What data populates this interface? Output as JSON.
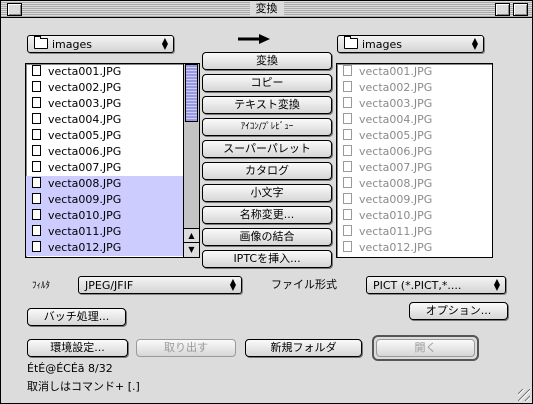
{
  "window": {
    "title": "変換"
  },
  "source": {
    "folder": "images",
    "files": [
      {
        "name": "vecta001.JPG",
        "selected": false
      },
      {
        "name": "vecta002.JPG",
        "selected": false
      },
      {
        "name": "vecta003.JPG",
        "selected": false
      },
      {
        "name": "vecta004.JPG",
        "selected": false
      },
      {
        "name": "vecta005.JPG",
        "selected": false
      },
      {
        "name": "vecta006.JPG",
        "selected": false
      },
      {
        "name": "vecta007.JPG",
        "selected": false
      },
      {
        "name": "vecta008.JPG",
        "selected": true
      },
      {
        "name": "vecta009.JPG",
        "selected": true
      },
      {
        "name": "vecta010.JPG",
        "selected": true
      },
      {
        "name": "vecta011.JPG",
        "selected": true
      },
      {
        "name": "vecta012.JPG",
        "selected": true
      }
    ]
  },
  "destination": {
    "folder": "images",
    "files": [
      "vecta001.JPG",
      "vecta002.JPG",
      "vecta003.JPG",
      "vecta004.JPG",
      "vecta005.JPG",
      "vecta006.JPG",
      "vecta007.JPG",
      "vecta008.JPG",
      "vecta009.JPG",
      "vecta010.JPG",
      "vecta011.JPG",
      "vecta012.JPG"
    ]
  },
  "actions": [
    {
      "id": "convert",
      "label": "変換"
    },
    {
      "id": "copy",
      "label": "コピー"
    },
    {
      "id": "text-convert",
      "label": "テキスト変換"
    },
    {
      "id": "icon-preview",
      "label": "ｱｲｺﾝ/ﾌﾟﾚﾋﾞｭｰ"
    },
    {
      "id": "super-palette",
      "label": "スーパーパレット"
    },
    {
      "id": "catalog",
      "label": "カタログ"
    },
    {
      "id": "lowercase",
      "label": "小文字"
    },
    {
      "id": "rename",
      "label": "名称変更..."
    },
    {
      "id": "combine-images",
      "label": "画像の結合"
    },
    {
      "id": "iptc-insert",
      "label": "IPTCを挿入..."
    }
  ],
  "filter": {
    "label": "ﾌｨﾙﾀ",
    "value": "JPEG/JFIF"
  },
  "file_format": {
    "label": "ファイル形式",
    "value": "PICT (*.PICT,*...."
  },
  "buttons": {
    "batch": "バッチ処理...",
    "options": "オプション...",
    "env_settings": "環境設定...",
    "eject": "取り出す",
    "new_folder": "新規フォルダ",
    "open": "開く"
  },
  "status": {
    "line1": "ÉtÉ@ÉCÉã 8/32",
    "line2": "取消しはコマンド+ [.]"
  },
  "icons": {
    "arrow": "right-arrow-icon",
    "folder": "folder-icon",
    "document": "document-icon",
    "popup": "up-down-arrows-icon"
  }
}
